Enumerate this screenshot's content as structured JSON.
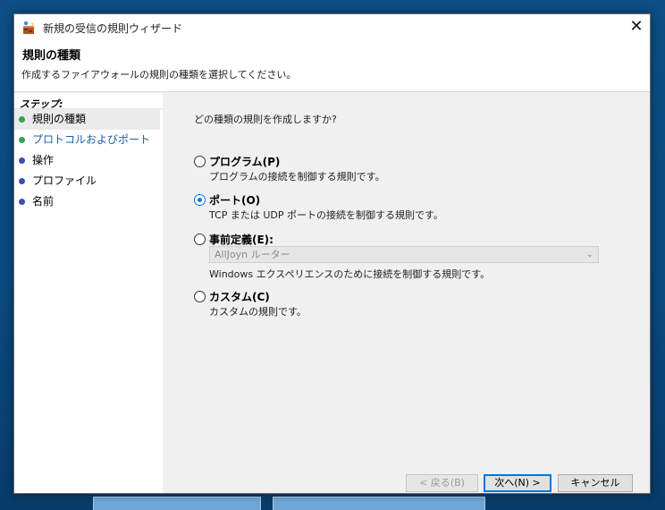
{
  "window": {
    "title": "新規の受信の規則ウィザード",
    "close_glyph": "✕"
  },
  "header": {
    "title": "規則の種類",
    "subtitle": "作成するファイアウォールの規則の種類を選択してください。"
  },
  "steps": {
    "heading": "ステップ:",
    "items": [
      {
        "label": "規則の種類",
        "bullet_color": "#2fa64a",
        "current": true
      },
      {
        "label": "プロトコルおよびポート",
        "bullet_color": "#2fa64a",
        "current": false
      },
      {
        "label": "操作",
        "bullet_color": "#3b4fb0",
        "current": false
      },
      {
        "label": "プロファイル",
        "bullet_color": "#3b4fb0",
        "current": false
      },
      {
        "label": "名前",
        "bullet_color": "#3b4fb0",
        "current": false
      }
    ]
  },
  "main": {
    "question": "どの種類の規則を作成しますか?",
    "options": [
      {
        "label": "プログラム(P)",
        "description": "プログラムの接続を制御する規則です。",
        "selected": false
      },
      {
        "label": "ポート(O)",
        "description": "TCP または UDP ポートの接続を制御する規則です。",
        "selected": true
      },
      {
        "label": "事前定義(E):",
        "combo_value": "AllJoyn ルーター",
        "description": "Windows エクスペリエンスのために接続を制御する規則です。",
        "selected": false
      },
      {
        "label": "カスタム(C)",
        "description": "カスタムの規則です。",
        "selected": false
      }
    ]
  },
  "buttons": {
    "back": "< 戻る(B)",
    "next": "次へ(N) >",
    "cancel": "キャンセル"
  },
  "icons": {
    "app_icon": "firewall-wizard-icon",
    "combo_arrow": "chevron-down-icon"
  }
}
